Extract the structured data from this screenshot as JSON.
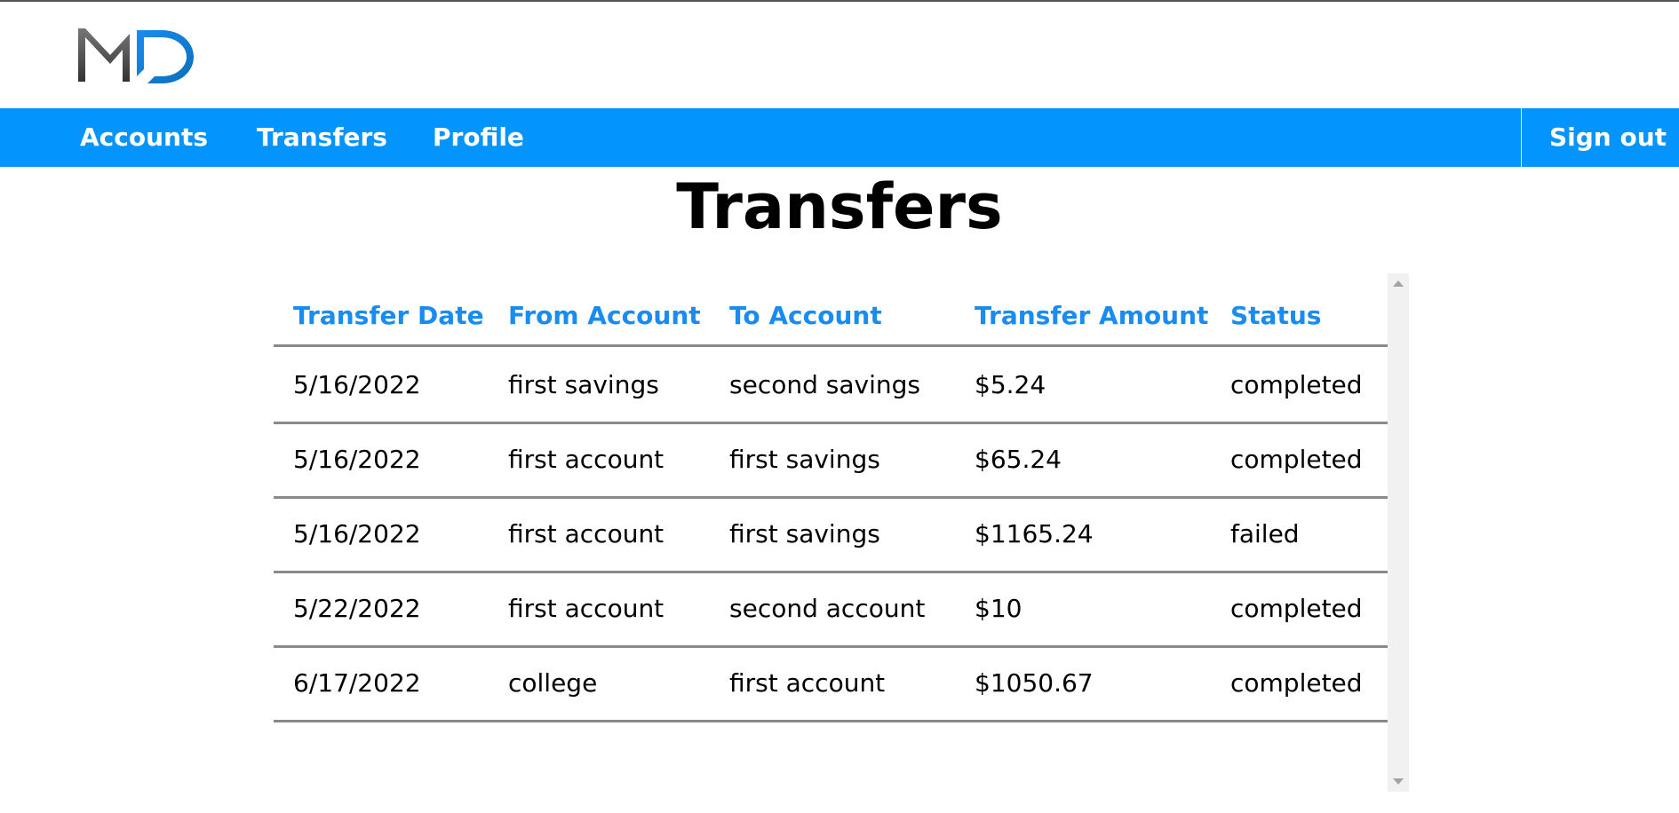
{
  "brand": {
    "logo_text": "MD",
    "colors": {
      "nav_bg": "#0394fd",
      "header_text": "#1a8cf0",
      "logo_gray": "#555555",
      "logo_blue": "#1a8cf0"
    }
  },
  "nav": {
    "items": [
      {
        "label": "Accounts"
      },
      {
        "label": "Transfers"
      },
      {
        "label": "Profile"
      }
    ],
    "signout_label": "Sign out"
  },
  "page": {
    "title": "Transfers"
  },
  "table": {
    "headers": [
      "Transfer Date",
      "From Account",
      "To Account",
      "Transfer Amount",
      "Status"
    ],
    "rows": [
      [
        "5/16/2022",
        "first savings",
        "second savings",
        "$5.24",
        "completed"
      ],
      [
        "5/16/2022",
        "first account",
        "first savings",
        "$65.24",
        "completed"
      ],
      [
        "5/16/2022",
        "first account",
        "first savings",
        "$1165.24",
        "failed"
      ],
      [
        "5/22/2022",
        "first account",
        "second account",
        "$10",
        "completed"
      ],
      [
        "6/17/2022",
        "college",
        "first account",
        "$1050.67",
        "completed"
      ]
    ]
  }
}
